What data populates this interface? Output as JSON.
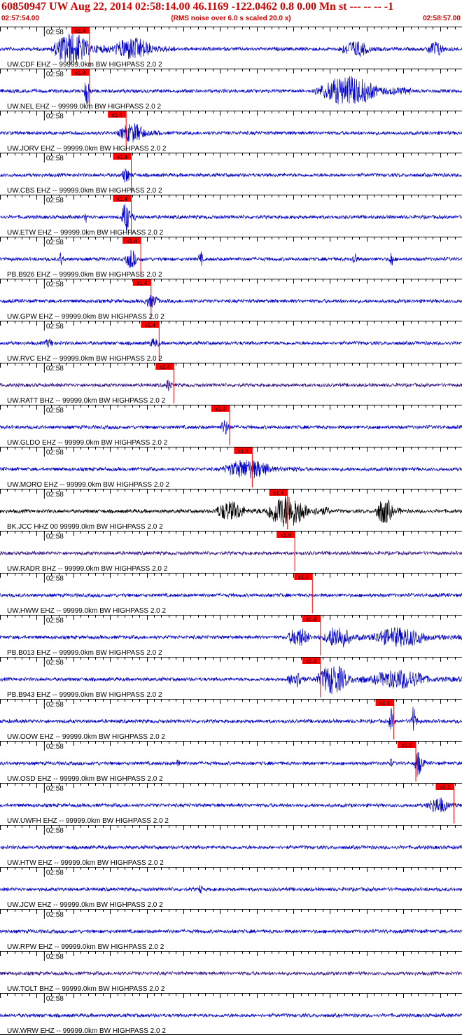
{
  "header": {
    "title": "60850947 UW Aug 22, 2014 02:58:14.00   46.1169 -122.0462  0.8 0.00 Mn st --- -- --  -1",
    "start_time": "02:57:54.00",
    "end_time": "02:58:57.00",
    "subtitle": "(RMS noise over 6.0 s scaled 20.0 x)"
  },
  "colors": {
    "header_text": "#d40000",
    "trace_default": "#0000cc",
    "pick_marker": "#ff0000",
    "axis": "#000000"
  },
  "chart_data": {
    "type": "line",
    "x_range_seconds": [
      0,
      63
    ],
    "minute_label": "02:58",
    "minute_mark_second": 6,
    "pick_label": "x1.4",
    "traces": [
      {
        "label": "UW.CDF EHZ -- 99999.0km BW  HIGHPASS  2.0  2",
        "color": "#0000cc",
        "pick_s": 12.2,
        "bursts": [
          [
            7,
            15,
            1.0
          ],
          [
            15,
            24,
            0.7
          ],
          [
            46,
            53,
            0.5
          ],
          [
            58,
            62,
            0.5
          ]
        ]
      },
      {
        "label": "UW.NEL EHZ -- 99999.0km BW  HIGHPASS  2.0  2",
        "color": "#0000cc",
        "pick_s": 12.2,
        "bursts": [
          [
            11.5,
            12.5,
            1.0
          ],
          [
            43,
            56,
            0.9
          ]
        ]
      },
      {
        "label": "UW.JORV EHZ -- 99999.0km BW  HIGHPASS  2.0  2",
        "color": "#0000cc",
        "pick_s": 17.2,
        "bursts": [
          [
            16,
            22,
            0.6
          ]
        ]
      },
      {
        "label": "UW.CBS EHZ -- 99999.0km BW  HIGHPASS  2.0  2",
        "color": "#0000cc",
        "pick_s": 17.9,
        "bursts": [
          [
            16.5,
            18.5,
            0.5
          ]
        ]
      },
      {
        "label": "UW.ETW EHZ -- 99999.0km BW  HIGHPASS  2.0  2",
        "color": "#0000cc",
        "pick_s": 17.9,
        "bursts": [
          [
            11.5,
            12,
            0.4
          ],
          [
            16.5,
            18.5,
            0.9
          ]
        ]
      },
      {
        "label": "PB.B926 EHZ -- 99999.0km BW  HIGHPASS  2.0  2",
        "color": "#0000cc",
        "pick_s": 19.2,
        "bursts": [
          [
            8,
            9,
            0.5
          ],
          [
            17,
            19.5,
            0.6
          ],
          [
            27,
            28,
            0.5
          ],
          [
            48,
            49,
            0.5
          ],
          [
            53,
            54,
            0.5
          ]
        ]
      },
      {
        "label": "UW.GPW EHZ -- 99999.0km BW  HIGHPASS  2.0  2",
        "color": "#0000cc",
        "pick_s": 20.6,
        "bursts": [
          [
            19.5,
            23,
            0.4
          ]
        ]
      },
      {
        "label": "UW.RVC EHZ -- 99999.0km BW  HIGHPASS  2.0  2",
        "color": "#0000cc",
        "pick_s": 21.7,
        "bursts": [
          [
            6,
            8,
            0.3
          ],
          [
            20,
            23,
            0.3
          ]
        ]
      },
      {
        "label": "UW.RATT BHZ -- 99999.0km BW  HIGHPASS  2.0  2",
        "color": "#331188",
        "pick_s": 23.7,
        "bursts": [
          [
            22.5,
            24,
            0.4
          ]
        ]
      },
      {
        "label": "UW.GLDO EHZ -- 99999.0km BW  HIGHPASS  2.0  2",
        "color": "#0000cc",
        "pick_s": 31.3,
        "bursts": [
          [
            30,
            32,
            0.5
          ]
        ]
      },
      {
        "label": "UW.MORO EHZ -- 99999.0km BW  HIGHPASS  2.0  2",
        "color": "#0000cc",
        "pick_s": 34.4,
        "bursts": [
          [
            30,
            41,
            0.6
          ]
        ]
      },
      {
        "label": "BK.JCC HHZ 00 99999.0km BW  HIGHPASS  2.0  2",
        "color": "#000000",
        "pick_s": 39.2,
        "bursts": [
          [
            29,
            36,
            0.6
          ],
          [
            36,
            45,
            1.0
          ],
          [
            51,
            55,
            0.8
          ]
        ]
      },
      {
        "label": "UW.RADR BHZ -- 99999.0km BW  HIGHPASS  2.0  2",
        "color": "#331188",
        "pick_s": 40.2,
        "bursts": []
      },
      {
        "label": "UW.HWW EHZ -- 99999.0km BW  HIGHPASS  2.0  2",
        "color": "#0000cc",
        "pick_s": 42.6,
        "bursts": []
      },
      {
        "label": "PB.B013 EHZ -- 99999.0km BW  HIGHPASS  2.0  2",
        "color": "#0000cc",
        "pick_s": 43.7,
        "bursts": [
          [
            39,
            44,
            0.6
          ],
          [
            44,
            50,
            0.7
          ],
          [
            50,
            63,
            0.6
          ]
        ]
      },
      {
        "label": "PB.B943 EHZ -- 99999.0km BW  HIGHPASS  2.0  2",
        "color": "#0000cc",
        "pick_s": 43.7,
        "bursts": [
          [
            39,
            43,
            0.5
          ],
          [
            43,
            50,
            0.9
          ],
          [
            50,
            63,
            0.6
          ]
        ]
      },
      {
        "label": "UW.OOW EHZ -- 99999.0km BW  HIGHPASS  2.0  2",
        "color": "#0000cc",
        "pick_s": 53.7,
        "bursts": [
          [
            53,
            54,
            0.8
          ],
          [
            56,
            57,
            1.0
          ]
        ]
      },
      {
        "label": "UW.OSD EHZ -- 99999.0km BW  HIGHPASS  2.0  2",
        "color": "#0000cc",
        "pick_s": 56.7,
        "bursts": [
          [
            24,
            25,
            0.3
          ],
          [
            53,
            54,
            0.3
          ],
          [
            56.5,
            58,
            0.9
          ]
        ]
      },
      {
        "label": "UW.UWFH EHZ -- 99999.0km BW  HIGHPASS  2.0  2",
        "color": "#0000cc",
        "pick_s": 61.9,
        "bursts": [
          [
            58,
            63,
            0.5
          ]
        ]
      },
      {
        "label": "UW.HTW EHZ -- 99999.0km BW  HIGHPASS  2.0  2",
        "color": "#0000cc",
        "pick_s": null,
        "bursts": []
      },
      {
        "label": "UW.JCW EHZ -- 99999.0km BW  HIGHPASS  2.0  2",
        "color": "#0000cc",
        "pick_s": null,
        "bursts": [
          [
            27,
            28,
            0.3
          ]
        ]
      },
      {
        "label": "UW.RPW EHZ -- 99999.0km BW  HIGHPASS  2.0  2",
        "color": "#0000cc",
        "pick_s": null,
        "bursts": []
      },
      {
        "label": "UW.TOLT BHZ -- 99999.0km BW  HIGHPASS  2.0  2",
        "color": "#331188",
        "pick_s": null,
        "bursts": []
      },
      {
        "label": "UW.WRW EHZ -- 99999.0km BW  HIGHPASS  2.0  2",
        "color": "#0000cc",
        "pick_s": null,
        "bursts": []
      }
    ]
  }
}
